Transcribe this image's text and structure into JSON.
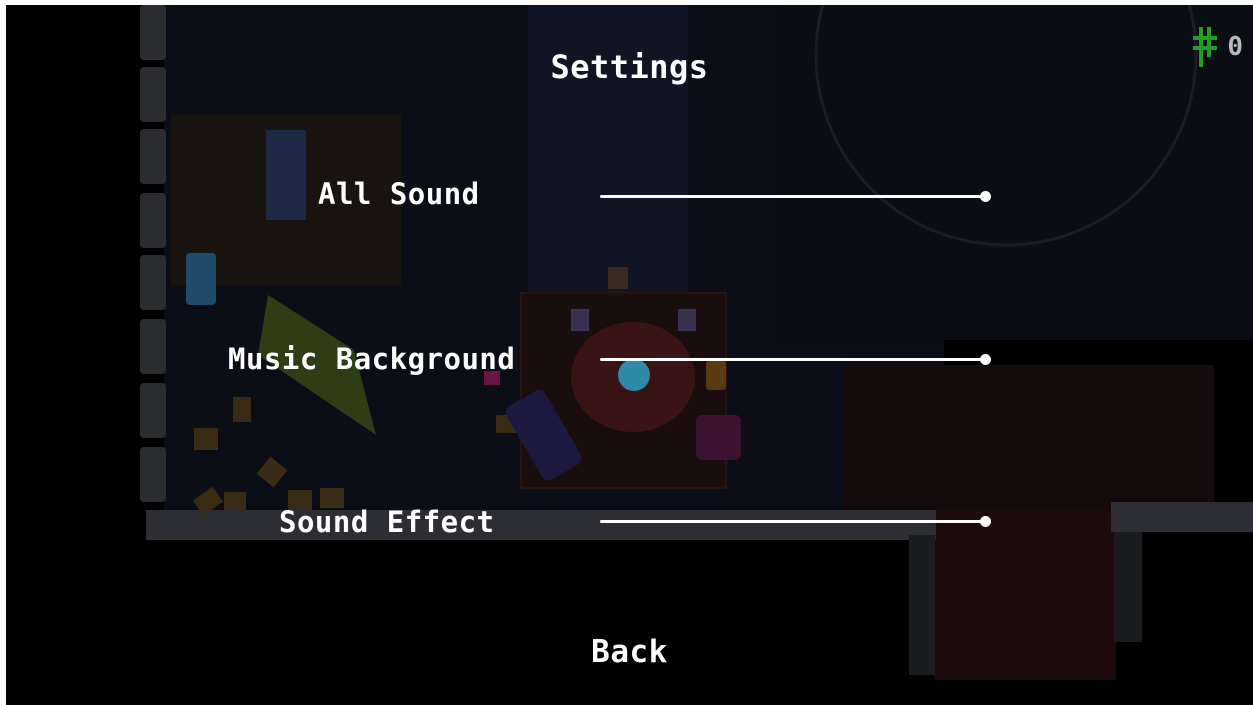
{
  "menu": {
    "title": "Settings",
    "back_label": "Back"
  },
  "sliders": [
    {
      "label": "All Sound",
      "value": 1.0
    },
    {
      "label": "Music Background",
      "value": 1.0
    },
    {
      "label": "Sound Effect",
      "value": 1.0
    }
  ],
  "hud": {
    "coin_count": "0",
    "coin_icon": "hash-coin-icon",
    "coin_color": "#1f9e2a"
  },
  "colors": {
    "menu_text": "#ffffff",
    "background": "#000000"
  }
}
